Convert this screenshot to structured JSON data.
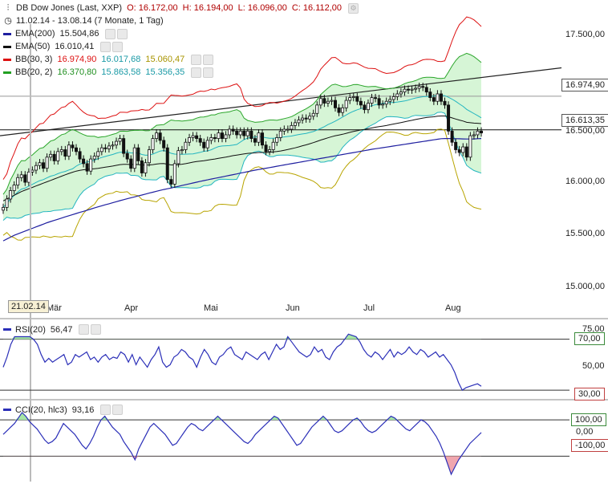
{
  "header": {
    "instrument": "DB Dow Jones (Last, XXP)",
    "open": "O: 16.172,00",
    "high": "H: 16.194,00",
    "low": "L: 16.096,00",
    "close": "C: 16.112,00",
    "range": "11.02.14 - 13.08.14 (7 Monate, 1 Tag)"
  },
  "legend": [
    {
      "label": "EMA(200)",
      "values": [
        "15.504,86"
      ],
      "color": "#1f1fa0"
    },
    {
      "label": "EMA(50)",
      "values": [
        "16.010,41"
      ],
      "color": "#111111"
    },
    {
      "label": "BB(30, 3)",
      "values": [
        "16.974,90",
        "16.017,68",
        "15.060,47"
      ],
      "colors": [
        "#dd1111",
        "#22b5c0",
        "#b8a400"
      ],
      "color": "#dd1111"
    },
    {
      "label": "BB(20, 2)",
      "values": [
        "16.370,80",
        "15.863,58",
        "15.356,35"
      ],
      "colors": [
        "#22a022",
        "#22b5c0",
        "#22b5c0"
      ],
      "color": "#22a022"
    }
  ],
  "price_axis": {
    "ticks": [
      "17.500,00",
      "16.500,00",
      "16.000,00",
      "15.500,00",
      "15.000,00"
    ],
    "tags": [
      "16.974,90",
      "16.613,35"
    ]
  },
  "x_axis": {
    "months": [
      "Mär",
      "Apr",
      "Mai",
      "Jun",
      "Jul",
      "Aug"
    ],
    "cursor_date": "21.02.14"
  },
  "rsi": {
    "label": "RSI(20)",
    "value": "56,47",
    "ticks": [
      "75,00",
      "50,00",
      "30,00"
    ],
    "tags": [
      "70,00",
      "30,00"
    ]
  },
  "cci": {
    "label": "CCI(20, hlc3)",
    "value": "93,16",
    "ticks": [
      "100,00",
      "0,00",
      "-100,00"
    ]
  },
  "chart_data": {
    "type": "candlestick",
    "title": "DB Dow Jones (Last, XXP)",
    "ylim": [
      14800,
      17750
    ],
    "dates_start": "11.02.14",
    "dates_end": "13.08.14",
    "close": [
      15780,
      15870,
      15960,
      16020,
      16100,
      16130,
      16050,
      16160,
      16180,
      16230,
      16260,
      16200,
      16320,
      16350,
      16280,
      16380,
      16400,
      16330,
      16450,
      16420,
      16380,
      16300,
      16250,
      16170,
      16300,
      16330,
      16380,
      16420,
      16410,
      16440,
      16450,
      16490,
      16520,
      16360,
      16300,
      16200,
      16420,
      16280,
      16150,
      16260,
      16400,
      16520,
      16580,
      16500,
      16420,
      16080,
      16030,
      16250,
      16390,
      16400,
      16480,
      16530,
      16550,
      16520,
      16480,
      16420,
      16500,
      16530,
      16520,
      16580,
      16520,
      16560,
      16620,
      16600,
      16560,
      16600,
      16550,
      16600,
      16520,
      16480,
      16580,
      16450,
      16380,
      16400,
      16480,
      16530,
      16600,
      16620,
      16620,
      16660,
      16690,
      16720,
      16740,
      16730,
      16760,
      16790,
      16880,
      16950,
      16900,
      16920,
      16930,
      16850,
      16800,
      16850,
      16930,
      16960,
      16970,
      16920,
      16880,
      16830,
      16900,
      16960,
      16950,
      16880,
      16890,
      16920,
      16940,
      16970,
      17000,
      17020,
      17050,
      17040,
      17050,
      17060,
      17080,
      17070,
      17020,
      16960,
      16920,
      17000,
      16920,
      16880,
      16600,
      16480,
      16400,
      16370,
      16430,
      16320,
      16550,
      16560,
      16600,
      16580
    ],
    "ema200": [
      15420,
      15440,
      15460,
      15480,
      15495,
      15510,
      15525,
      15540,
      15555,
      15570,
      15585,
      15600,
      15615,
      15628,
      15640,
      15652,
      15665,
      15678,
      15690,
      15702,
      15714,
      15726,
      15738,
      15750,
      15762,
      15774,
      15786,
      15797,
      15808,
      15819,
      15830,
      15841,
      15852,
      15863,
      15873,
      15883,
      15893,
      15903,
      15913,
      15923,
      15933,
      15943,
      15953,
      15963,
      15972,
      15980,
      15988,
      15997,
      16006,
      16015,
      16024,
      16033,
      16042,
      16051,
      16060,
      16068,
      16076,
      16084,
      16092,
      16100,
      16108,
      16116,
      16124,
      16132,
      16140,
      16148,
      16156,
      16164,
      16172,
      16180,
      16187,
      16194,
      16201,
      16208,
      16215,
      16222,
      16229,
      16236,
      16243,
      16250,
      16257,
      16264,
      16271,
      16278,
      16285,
      16292,
      16299,
      16306,
      16313,
      16320,
      16327,
      16334,
      16341,
      16348,
      16355,
      16362,
      16369,
      16376,
      16383,
      16390,
      16397,
      16404,
      16410,
      16416,
      16422,
      16428,
      16434,
      16440,
      16446,
      16452,
      16458,
      16464,
      16470,
      16476,
      16482,
      16488,
      16494,
      16500,
      16506,
      16512,
      16518,
      16520,
      16520,
      16519,
      16518,
      16517,
      16516,
      16515,
      16515,
      16516,
      16518,
      16520
    ],
    "ema50": [
      15850,
      15870,
      15890,
      15910,
      15930,
      15950,
      15965,
      15980,
      15995,
      16010,
      16025,
      16040,
      16055,
      16070,
      16085,
      16100,
      16115,
      16130,
      16145,
      16158,
      16170,
      16178,
      16184,
      16188,
      16192,
      16196,
      16200,
      16206,
      16212,
      16218,
      16224,
      16232,
      16240,
      16242,
      16242,
      16240,
      16242,
      16240,
      16236,
      16234,
      16236,
      16240,
      16246,
      16250,
      16252,
      16244,
      16236,
      16236,
      16240,
      16244,
      16250,
      16258,
      16266,
      16272,
      16278,
      16282,
      16288,
      16294,
      16300,
      16308,
      16314,
      16320,
      16328,
      16336,
      16342,
      16348,
      16354,
      16360,
      16364,
      16366,
      16370,
      16370,
      16370,
      16372,
      16376,
      16380,
      16386,
      16394,
      16402,
      16410,
      16420,
      16430,
      16442,
      16452,
      16464,
      16476,
      16490,
      16504,
      16516,
      16528,
      16540,
      16550,
      16558,
      16566,
      16576,
      16586,
      16596,
      16604,
      16612,
      16618,
      16626,
      16634,
      16642,
      16648,
      16654,
      16660,
      16668,
      16676,
      16684,
      16692,
      16700,
      16708,
      16716,
      16724,
      16732,
      16740,
      16746,
      16750,
      16754,
      16760,
      16762,
      16762,
      16754,
      16742,
      16730,
      16718,
      16708,
      16694,
      16690,
      16686,
      16684,
      16680
    ],
    "rsi": [
      48,
      56,
      66,
      72,
      72,
      72,
      72,
      72,
      70,
      66,
      58,
      52,
      55,
      52,
      54,
      56,
      58,
      50,
      52,
      58,
      56,
      58,
      60,
      54,
      56,
      52,
      56,
      58,
      54,
      56,
      55,
      60,
      58,
      52,
      58,
      50,
      56,
      52,
      48,
      54,
      58,
      64,
      52,
      48,
      50,
      56,
      58,
      62,
      60,
      56,
      54,
      48,
      56,
      62,
      58,
      52,
      50,
      56,
      58,
      62,
      64,
      58,
      56,
      54,
      60,
      58,
      56,
      54,
      58,
      60,
      54,
      60,
      66,
      62,
      64,
      72,
      68,
      64,
      60,
      58,
      56,
      58,
      64,
      60,
      62,
      56,
      54,
      60,
      64,
      66,
      70,
      74,
      73,
      72,
      68,
      62,
      58,
      56,
      60,
      58,
      54,
      58,
      62,
      56,
      60,
      58,
      60,
      64,
      60,
      58,
      62,
      60,
      56,
      58,
      60,
      56,
      58,
      54,
      50,
      44,
      36,
      30,
      32,
      33,
      34,
      35,
      33
    ],
    "cci": [
      20,
      40,
      60,
      80,
      110,
      140,
      120,
      90,
      70,
      50,
      20,
      -10,
      -30,
      -20,
      0,
      40,
      80,
      60,
      40,
      20,
      -10,
      -40,
      -60,
      -30,
      10,
      60,
      100,
      120,
      90,
      60,
      40,
      20,
      -20,
      -50,
      -80,
      -120,
      -60,
      -20,
      20,
      60,
      80,
      60,
      40,
      20,
      -10,
      -40,
      -30,
      0,
      30,
      60,
      80,
      70,
      50,
      40,
      60,
      80,
      100,
      120,
      100,
      80,
      60,
      40,
      20,
      0,
      -20,
      -30,
      -10,
      20,
      40,
      60,
      80,
      100,
      120,
      110,
      80,
      50,
      20,
      -10,
      -40,
      -30,
      0,
      30,
      60,
      80,
      100,
      120,
      100,
      70,
      40,
      30,
      40,
      60,
      80,
      100,
      110,
      90,
      60,
      40,
      30,
      40,
      60,
      80,
      100,
      120,
      110,
      90,
      70,
      50,
      40,
      60,
      80,
      100,
      90,
      70,
      40,
      10,
      -30,
      -80,
      -140,
      -200,
      -160,
      -120,
      -90,
      -60,
      -30,
      -10,
      10,
      30
    ]
  }
}
